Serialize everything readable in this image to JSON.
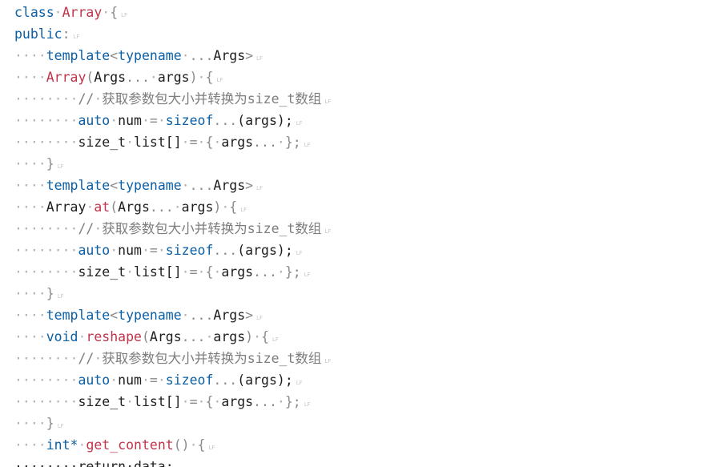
{
  "editor": {
    "whitespace_marker": "·",
    "line_end_marker": "LF",
    "lines": [
      [
        {
          "t": "class",
          "c": "kw"
        },
        {
          "t": "·",
          "c": "ws"
        },
        {
          "t": "Array",
          "c": "fn"
        },
        {
          "t": "·",
          "c": "ws"
        },
        {
          "t": "{",
          "c": "op"
        }
      ],
      [
        {
          "t": "public",
          "c": "kw"
        },
        {
          "t": ":",
          "c": "op"
        }
      ],
      [
        {
          "t": "····",
          "c": "ws"
        },
        {
          "t": "template",
          "c": "kw"
        },
        {
          "t": "<",
          "c": "op"
        },
        {
          "t": "typename",
          "c": "kw"
        },
        {
          "t": "·",
          "c": "ws"
        },
        {
          "t": "...",
          "c": "op"
        },
        {
          "t": "Args",
          "c": "ty"
        },
        {
          "t": ">",
          "c": "op"
        }
      ],
      [
        {
          "t": "····",
          "c": "ws"
        },
        {
          "t": "Array",
          "c": "fn"
        },
        {
          "t": "(",
          "c": "op"
        },
        {
          "t": "Args",
          "c": "ty"
        },
        {
          "t": "...",
          "c": "op"
        },
        {
          "t": "·",
          "c": "ws"
        },
        {
          "t": "args",
          "c": "ty"
        },
        {
          "t": ")",
          "c": "op"
        },
        {
          "t": "·",
          "c": "ws"
        },
        {
          "t": "{",
          "c": "op"
        }
      ],
      [
        {
          "t": "········",
          "c": "ws"
        },
        {
          "t": "//",
          "c": "cm"
        },
        {
          "t": "·",
          "c": "ws"
        },
        {
          "t": "获取参数包大小并转换为size_t数组",
          "c": "cm"
        }
      ],
      [
        {
          "t": "········",
          "c": "ws"
        },
        {
          "t": "auto",
          "c": "kw"
        },
        {
          "t": "·",
          "c": "ws"
        },
        {
          "t": "num",
          "c": "ty"
        },
        {
          "t": "·",
          "c": "ws"
        },
        {
          "t": "=",
          "c": "op"
        },
        {
          "t": "·",
          "c": "ws"
        },
        {
          "t": "sizeof",
          "c": "kw"
        },
        {
          "t": "...",
          "c": "op"
        },
        {
          "t": "(args);",
          "c": "ty"
        }
      ],
      [
        {
          "t": "········",
          "c": "ws"
        },
        {
          "t": "size_t",
          "c": "ty"
        },
        {
          "t": "·",
          "c": "ws"
        },
        {
          "t": "list[]",
          "c": "ty"
        },
        {
          "t": "·",
          "c": "ws"
        },
        {
          "t": "=",
          "c": "op"
        },
        {
          "t": "·",
          "c": "ws"
        },
        {
          "t": "{",
          "c": "op"
        },
        {
          "t": "·",
          "c": "ws"
        },
        {
          "t": "args",
          "c": "ty"
        },
        {
          "t": "...",
          "c": "op"
        },
        {
          "t": "·",
          "c": "ws"
        },
        {
          "t": "};",
          "c": "op"
        }
      ],
      [
        {
          "t": "····",
          "c": "ws"
        },
        {
          "t": "}",
          "c": "op"
        }
      ],
      [
        {
          "t": "····",
          "c": "ws"
        },
        {
          "t": "template",
          "c": "kw"
        },
        {
          "t": "<",
          "c": "op"
        },
        {
          "t": "typename",
          "c": "kw"
        },
        {
          "t": "·",
          "c": "ws"
        },
        {
          "t": "...",
          "c": "op"
        },
        {
          "t": "Args",
          "c": "ty"
        },
        {
          "t": ">",
          "c": "op"
        }
      ],
      [
        {
          "t": "····",
          "c": "ws"
        },
        {
          "t": "Array",
          "c": "ty"
        },
        {
          "t": "·",
          "c": "ws"
        },
        {
          "t": "at",
          "c": "fn"
        },
        {
          "t": "(",
          "c": "op"
        },
        {
          "t": "Args",
          "c": "ty"
        },
        {
          "t": "...",
          "c": "op"
        },
        {
          "t": "·",
          "c": "ws"
        },
        {
          "t": "args",
          "c": "ty"
        },
        {
          "t": ")",
          "c": "op"
        },
        {
          "t": "·",
          "c": "ws"
        },
        {
          "t": "{",
          "c": "op"
        }
      ],
      [
        {
          "t": "········",
          "c": "ws"
        },
        {
          "t": "//",
          "c": "cm"
        },
        {
          "t": "·",
          "c": "ws"
        },
        {
          "t": "获取参数包大小并转换为size_t数组",
          "c": "cm"
        }
      ],
      [
        {
          "t": "········",
          "c": "ws"
        },
        {
          "t": "auto",
          "c": "kw"
        },
        {
          "t": "·",
          "c": "ws"
        },
        {
          "t": "num",
          "c": "ty"
        },
        {
          "t": "·",
          "c": "ws"
        },
        {
          "t": "=",
          "c": "op"
        },
        {
          "t": "·",
          "c": "ws"
        },
        {
          "t": "sizeof",
          "c": "kw"
        },
        {
          "t": "...",
          "c": "op"
        },
        {
          "t": "(args);",
          "c": "ty"
        }
      ],
      [
        {
          "t": "········",
          "c": "ws"
        },
        {
          "t": "size_t",
          "c": "ty"
        },
        {
          "t": "·",
          "c": "ws"
        },
        {
          "t": "list[]",
          "c": "ty"
        },
        {
          "t": "·",
          "c": "ws"
        },
        {
          "t": "=",
          "c": "op"
        },
        {
          "t": "·",
          "c": "ws"
        },
        {
          "t": "{",
          "c": "op"
        },
        {
          "t": "·",
          "c": "ws"
        },
        {
          "t": "args",
          "c": "ty"
        },
        {
          "t": "...",
          "c": "op"
        },
        {
          "t": "·",
          "c": "ws"
        },
        {
          "t": "};",
          "c": "op"
        }
      ],
      [
        {
          "t": "····",
          "c": "ws"
        },
        {
          "t": "}",
          "c": "op"
        }
      ],
      [
        {
          "t": "····",
          "c": "ws"
        },
        {
          "t": "template",
          "c": "kw"
        },
        {
          "t": "<",
          "c": "op"
        },
        {
          "t": "typename",
          "c": "kw"
        },
        {
          "t": "·",
          "c": "ws"
        },
        {
          "t": "...",
          "c": "op"
        },
        {
          "t": "Args",
          "c": "ty"
        },
        {
          "t": ">",
          "c": "op"
        }
      ],
      [
        {
          "t": "····",
          "c": "ws"
        },
        {
          "t": "void",
          "c": "kw"
        },
        {
          "t": "·",
          "c": "ws"
        },
        {
          "t": "reshape",
          "c": "fn"
        },
        {
          "t": "(",
          "c": "op"
        },
        {
          "t": "Args",
          "c": "ty"
        },
        {
          "t": "...",
          "c": "op"
        },
        {
          "t": "·",
          "c": "ws"
        },
        {
          "t": "args",
          "c": "ty"
        },
        {
          "t": ")",
          "c": "op"
        },
        {
          "t": "·",
          "c": "ws"
        },
        {
          "t": "{",
          "c": "op"
        }
      ],
      [
        {
          "t": "········",
          "c": "ws"
        },
        {
          "t": "//",
          "c": "cm"
        },
        {
          "t": "·",
          "c": "ws"
        },
        {
          "t": "获取参数包大小并转换为size_t数组",
          "c": "cm"
        }
      ],
      [
        {
          "t": "········",
          "c": "ws"
        },
        {
          "t": "auto",
          "c": "kw"
        },
        {
          "t": "·",
          "c": "ws"
        },
        {
          "t": "num",
          "c": "ty"
        },
        {
          "t": "·",
          "c": "ws"
        },
        {
          "t": "=",
          "c": "op"
        },
        {
          "t": "·",
          "c": "ws"
        },
        {
          "t": "sizeof",
          "c": "kw"
        },
        {
          "t": "...",
          "c": "op"
        },
        {
          "t": "(args);",
          "c": "ty"
        }
      ],
      [
        {
          "t": "········",
          "c": "ws"
        },
        {
          "t": "size_t",
          "c": "ty"
        },
        {
          "t": "·",
          "c": "ws"
        },
        {
          "t": "list[]",
          "c": "ty"
        },
        {
          "t": "·",
          "c": "ws"
        },
        {
          "t": "=",
          "c": "op"
        },
        {
          "t": "·",
          "c": "ws"
        },
        {
          "t": "{",
          "c": "op"
        },
        {
          "t": "·",
          "c": "ws"
        },
        {
          "t": "args",
          "c": "ty"
        },
        {
          "t": "...",
          "c": "op"
        },
        {
          "t": "·",
          "c": "ws"
        },
        {
          "t": "};",
          "c": "op"
        }
      ],
      [
        {
          "t": "····",
          "c": "ws"
        },
        {
          "t": "}",
          "c": "op"
        }
      ],
      [
        {
          "t": "····",
          "c": "ws"
        },
        {
          "t": "int*",
          "c": "kw"
        },
        {
          "t": "·",
          "c": "ws"
        },
        {
          "t": "get_content",
          "c": "fn"
        },
        {
          "t": "()",
          "c": "op"
        },
        {
          "t": "·",
          "c": "ws"
        },
        {
          "t": "{",
          "c": "op"
        }
      ]
    ],
    "partial_line": "········return·data;"
  },
  "colors": {
    "keyword": "#0b5fa5",
    "function_name": "#c1344a",
    "comment": "#7d7d7d",
    "whitespace_marker": "#b0b0b0"
  }
}
